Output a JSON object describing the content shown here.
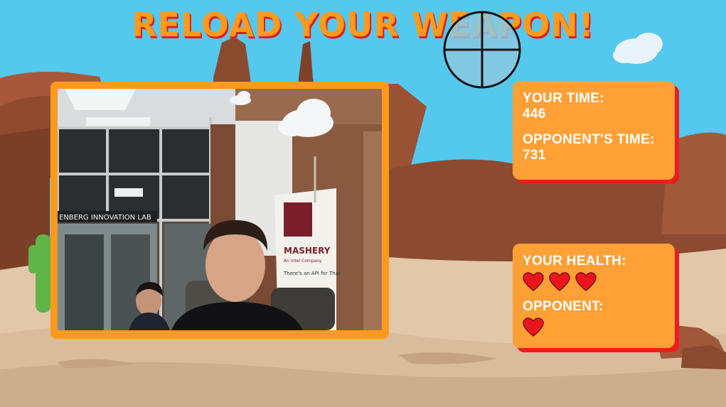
{
  "game": {
    "banner": "RELOAD YOUR WEAPON!"
  },
  "hud": {
    "time": {
      "your_label": "YOUR TIME:",
      "your_value": "446",
      "opponent_label": "OPPONENT'S TIME:",
      "opponent_value": "731"
    },
    "health": {
      "your_label": "YOUR HEALTH:",
      "your_hearts": 3,
      "opponent_label": "OPPONENT:",
      "opponent_hearts": 1
    }
  },
  "webcam": {
    "sign_text": "ENBERG INNOVATION LAB",
    "banner_title": "MASHERY",
    "banner_subtitle": "An Intel Company",
    "banner_tagline": "There's an API for That"
  },
  "colors": {
    "sky": "#55c8ee",
    "banner_fill": "#ff9a1c",
    "banner_shadow": "#e21d1d",
    "panel": "#ffa036",
    "panel_shadow": "#ee1c1c",
    "heart": "#e8161c"
  },
  "icons": {
    "crosshair": "crosshair-icon",
    "heart": "heart-icon",
    "cloud": "cloud-icon",
    "cactus": "cactus-icon"
  }
}
